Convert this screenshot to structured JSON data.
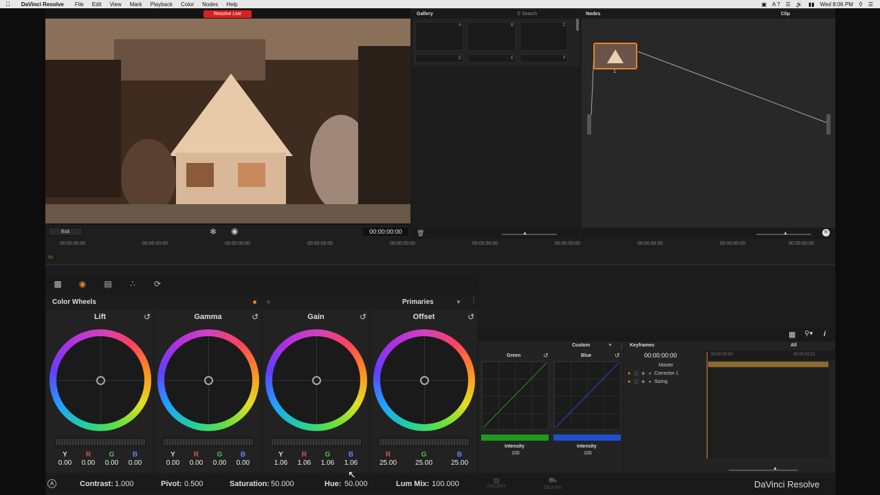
{
  "menubar": {
    "app_name": "DaVinci Resolve",
    "items": [
      "File",
      "Edit",
      "View",
      "Mark",
      "Playback",
      "Color",
      "Nodes",
      "Help"
    ],
    "status_icons": [
      "A 7"
    ],
    "clock": "Wed 8:06 PM"
  },
  "viewer": {
    "live_badge": "Resolve Live",
    "exit_label": "Exit",
    "timecode": "00:00:00:00"
  },
  "gallery": {
    "title": "Gallery",
    "search_placeholder": "Search",
    "slots": [
      "A",
      "B",
      "C",
      "D",
      "E",
      "F"
    ]
  },
  "nodes": {
    "title": "Nodes",
    "mode": "Clip",
    "node_label": "1"
  },
  "timeline": {
    "ticks": [
      "00:00:00:00",
      "00:00:00:00",
      "00:00:00:00",
      "00:00:00:00",
      "00:00:00:00",
      "00:00:00:00",
      "00:00:00:00",
      "00:00:00:00",
      "00:00:00:00",
      "00:00:00:00"
    ],
    "track": "V1"
  },
  "color_wheels": {
    "title": "Color Wheels",
    "mode": "Primaries",
    "wheels": [
      {
        "name": "Lift",
        "labels": [
          "Y",
          "R",
          "G",
          "B"
        ],
        "values": [
          "0.00",
          "0.00",
          "0.00",
          "0.00"
        ]
      },
      {
        "name": "Gamma",
        "labels": [
          "Y",
          "R",
          "G",
          "B"
        ],
        "values": [
          "0.00",
          "0.00",
          "0.00",
          "0.00"
        ]
      },
      {
        "name": "Gain",
        "labels": [
          "Y",
          "R",
          "G",
          "B"
        ],
        "values": [
          "1.06",
          "1.06",
          "1.06",
          "1.06"
        ]
      },
      {
        "name": "Offset",
        "labels": [
          "R",
          "G",
          "B"
        ],
        "values": [
          "25.00",
          "25.00",
          "25.00"
        ]
      }
    ],
    "footer": {
      "contrast_label": "Contrast:",
      "contrast": "1.000",
      "pivot_label": "Pivot:",
      "pivot": "0.500",
      "saturation_label": "Saturation:",
      "saturation": "50.000",
      "hue_label": "Hue:",
      "hue": "50.000",
      "lummix_label": "Lum Mix:",
      "lummix": "100.000"
    }
  },
  "curves": {
    "mode": "Custom",
    "green_label": "Green",
    "blue_label": "Blue",
    "intensity_label": "Intensity",
    "green_intensity": "100",
    "blue_intensity": "100"
  },
  "keyframes": {
    "title": "Keyframes",
    "filter": "All",
    "timecode": "00:00:00:00",
    "ruler_start": "00:00:00:00",
    "ruler_end": "00:00:02:21",
    "rows": [
      "Master",
      "Corrector 1",
      "Sizing"
    ]
  },
  "bottom_nav": {
    "gallery": "GALLERY",
    "deliver": "DELIVER",
    "brand": "DaVinci Resolve"
  },
  "colors": {
    "accent": "#e8832a",
    "live_red": "#d92020",
    "green_bar": "#1e9a1e",
    "blue_bar": "#1e4fd0"
  }
}
